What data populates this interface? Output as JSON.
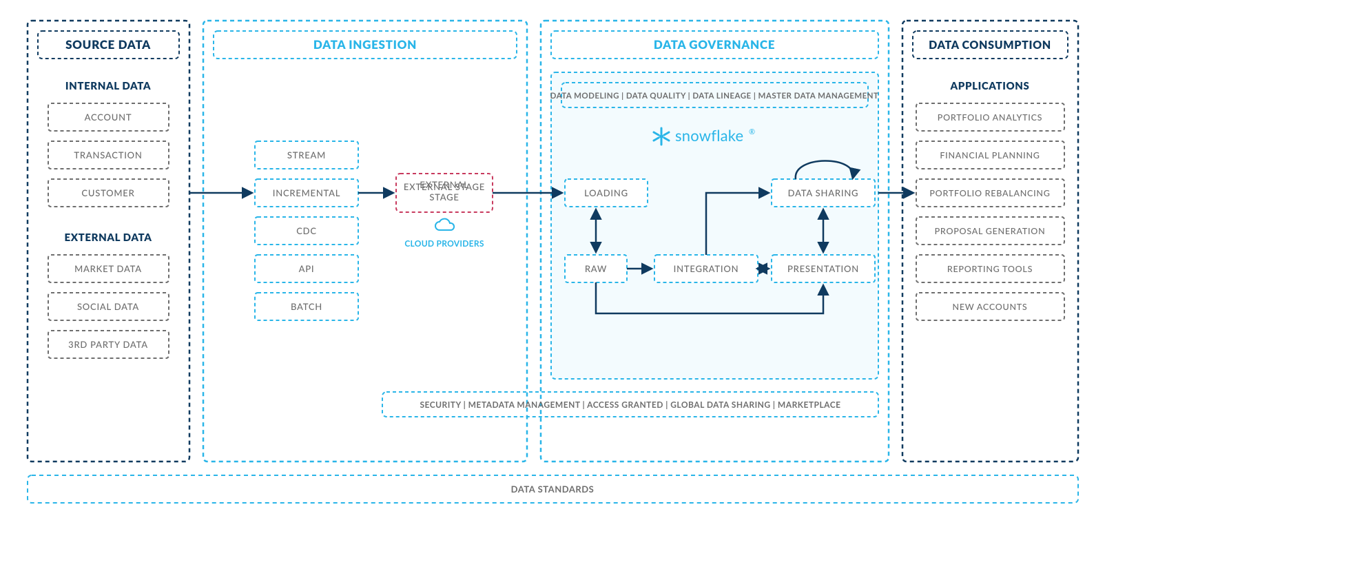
{
  "columns": {
    "source": {
      "title": "SOURCE DATA",
      "internal_label": "INTERNAL DATA",
      "internal": [
        "ACCOUNT",
        "TRANSACTION",
        "CUSTOMER"
      ],
      "external_label": "EXTERNAL DATA",
      "external": [
        "MARKET DATA",
        "SOCIAL DATA",
        "3RD PARTY DATA"
      ]
    },
    "ingestion": {
      "title": "DATA INGESTION",
      "methods": [
        "STREAM",
        "INCREMENTAL",
        "CDC",
        "API",
        "BATCH"
      ],
      "external_stage": "EXTERNAL STAGE",
      "cloud_providers": "CLOUD PROVIDERS"
    },
    "governance": {
      "title": "DATA GOVERNANCE",
      "top_bar": "DATA MODELING | DATA QUALITY | DATA LINEAGE | MASTER DATA MANAGEMENT",
      "brand": "snowflake",
      "nodes": {
        "loading": "LOADING",
        "raw": "RAW",
        "integration": "INTEGRATION",
        "presentation": "PRESENTATION",
        "data_sharing": "DATA SHARING"
      }
    },
    "consumption": {
      "title": "DATA CONSUMPTION",
      "apps_label": "APPLICATIONS",
      "apps": [
        "PORTFOLIO ANALYTICS",
        "FINANCIAL PLANNING",
        "PORTFOLIO REBALANCING",
        "PROPOSAL GENERATION",
        "REPORTING TOOLS",
        "NEW ACCOUNTS"
      ]
    }
  },
  "bottom_bar": "SECURITY | METADATA MANAGEMENT | ACCESS GRANTED | GLOBAL DATA SHARING | MARKETPLACE",
  "standards_bar": "DATA STANDARDS",
  "colors": {
    "navy": "#0f3a5f",
    "cyan": "#29b5e8",
    "grey": "#6e6e6e",
    "crimson": "#c83a5e",
    "panel_tint": "#f3fbfe"
  }
}
